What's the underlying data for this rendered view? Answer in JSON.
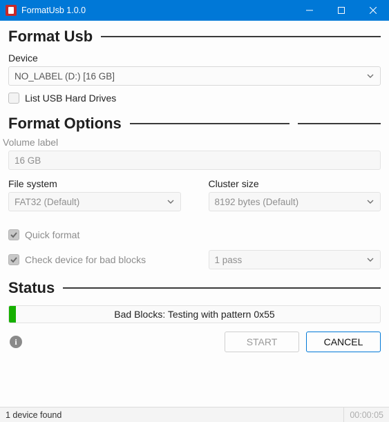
{
  "window": {
    "title": "FormatUsb 1.0.0"
  },
  "section_format_usb": {
    "heading": "Format Usb",
    "device_label": "Device",
    "device_value": "NO_LABEL (D:) [16 GB]",
    "list_usb_hdd_label": "List USB Hard Drives",
    "list_usb_hdd_checked": false
  },
  "section_format_options": {
    "heading": "Format Options",
    "volume_label_label": "Volume label",
    "volume_label_value": "16 GB",
    "file_system_label": "File system",
    "file_system_value": "FAT32 (Default)",
    "cluster_size_label": "Cluster size",
    "cluster_size_value": "8192 bytes (Default)",
    "quick_format_label": "Quick format",
    "quick_format_checked": true,
    "bad_blocks_label": "Check device for bad blocks",
    "bad_blocks_checked": true,
    "bad_blocks_passes_value": "1 pass"
  },
  "section_status": {
    "heading": "Status",
    "progress_text": "Bad Blocks: Testing with pattern 0x55"
  },
  "buttons": {
    "start": "START",
    "cancel": "CANCEL"
  },
  "statusbar": {
    "left": "1 device found",
    "right": "00:00:05"
  }
}
